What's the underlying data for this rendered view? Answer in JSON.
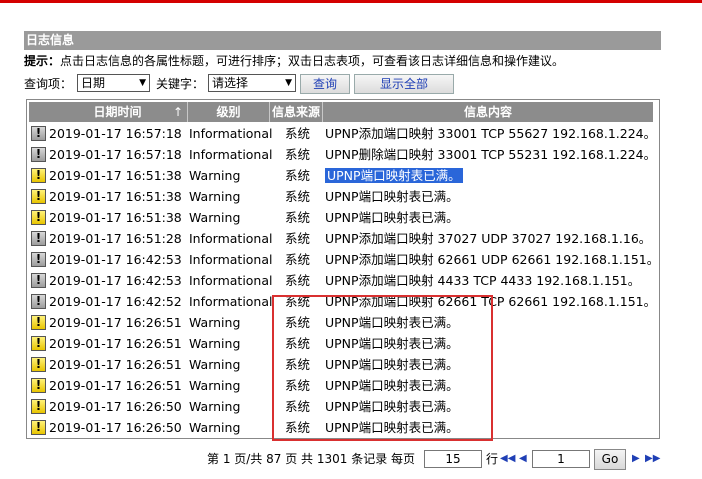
{
  "section_title": "日志信息",
  "hint": {
    "label": "提示：",
    "text": "点击日志信息的各属性标题，可进行排序；双击日志表项，可查看该日志详细信息和操作建议。"
  },
  "query": {
    "field_label": "查询项：",
    "field_value": "日期",
    "keyword_label": "关键字：",
    "keyword_value": "请选择",
    "search_button": "查询",
    "show_all_button": "显示全部"
  },
  "table": {
    "columns": [
      "日期时间",
      "级别",
      "信息来源",
      "信息内容"
    ],
    "sort_indicator": "↑",
    "rows": [
      {
        "icon": "info",
        "datetime": "2019-01-17 16:57:18",
        "level": "Informational",
        "source": "系统",
        "content": "UPNP添加端口映射 33001 TCP 55627 192.168.1.224。",
        "selected": false
      },
      {
        "icon": "info",
        "datetime": "2019-01-17 16:57:18",
        "level": "Informational",
        "source": "系统",
        "content": "UPNP删除端口映射 33001 TCP 55231 192.168.1.224。",
        "selected": false
      },
      {
        "icon": "warn",
        "datetime": "2019-01-17 16:51:38",
        "level": "Warning",
        "source": "系统",
        "content": "UPNP端口映射表已满。",
        "selected": true
      },
      {
        "icon": "warn",
        "datetime": "2019-01-17 16:51:38",
        "level": "Warning",
        "source": "系统",
        "content": "UPNP端口映射表已满。",
        "selected": false
      },
      {
        "icon": "warn",
        "datetime": "2019-01-17 16:51:38",
        "level": "Warning",
        "source": "系统",
        "content": "UPNP端口映射表已满。",
        "selected": false
      },
      {
        "icon": "info",
        "datetime": "2019-01-17 16:51:28",
        "level": "Informational",
        "source": "系统",
        "content": "UPNP添加端口映射 37027 UDP 37027 192.168.1.16。",
        "selected": false
      },
      {
        "icon": "info",
        "datetime": "2019-01-17 16:42:53",
        "level": "Informational",
        "source": "系统",
        "content": "UPNP添加端口映射 62661 UDP 62661 192.168.1.151。",
        "selected": false
      },
      {
        "icon": "info",
        "datetime": "2019-01-17 16:42:53",
        "level": "Informational",
        "source": "系统",
        "content": "UPNP添加端口映射 4433 TCP 4433 192.168.1.151。",
        "selected": false
      },
      {
        "icon": "info",
        "datetime": "2019-01-17 16:42:52",
        "level": "Informational",
        "source": "系统",
        "content": "UPNP添加端口映射 62661 TCP 62661 192.168.1.151。",
        "selected": false
      },
      {
        "icon": "warn",
        "datetime": "2019-01-17 16:26:51",
        "level": "Warning",
        "source": "系统",
        "content": "UPNP端口映射表已满。",
        "selected": false
      },
      {
        "icon": "warn",
        "datetime": "2019-01-17 16:26:51",
        "level": "Warning",
        "source": "系统",
        "content": "UPNP端口映射表已满。",
        "selected": false
      },
      {
        "icon": "warn",
        "datetime": "2019-01-17 16:26:51",
        "level": "Warning",
        "source": "系统",
        "content": "UPNP端口映射表已满。",
        "selected": false
      },
      {
        "icon": "warn",
        "datetime": "2019-01-17 16:26:51",
        "level": "Warning",
        "source": "系统",
        "content": "UPNP端口映射表已满。",
        "selected": false
      },
      {
        "icon": "warn",
        "datetime": "2019-01-17 16:26:50",
        "level": "Warning",
        "source": "系统",
        "content": "UPNP端口映射表已满。",
        "selected": false
      },
      {
        "icon": "warn",
        "datetime": "2019-01-17 16:26:50",
        "level": "Warning",
        "source": "系统",
        "content": "UPNP端口映射表已满。",
        "selected": false
      }
    ]
  },
  "pager": {
    "summary": "第 1 页/共 87 页 共 1301 条记录 每页",
    "per_page": "15",
    "rows_suffix": "行",
    "current_page": "1",
    "go_button": "Go",
    "icons": {
      "first": "first-page-icon",
      "prev": "prev-page-icon",
      "next": "next-page-icon",
      "last": "last-page-icon"
    }
  },
  "colors": {
    "top_bar": "#d40000",
    "title_bar": "#9a9a9a",
    "header": "#8c8c8c",
    "selection": "#2a66d9",
    "annotation_box": "#d93030",
    "warning_icon": "#f2d600"
  }
}
